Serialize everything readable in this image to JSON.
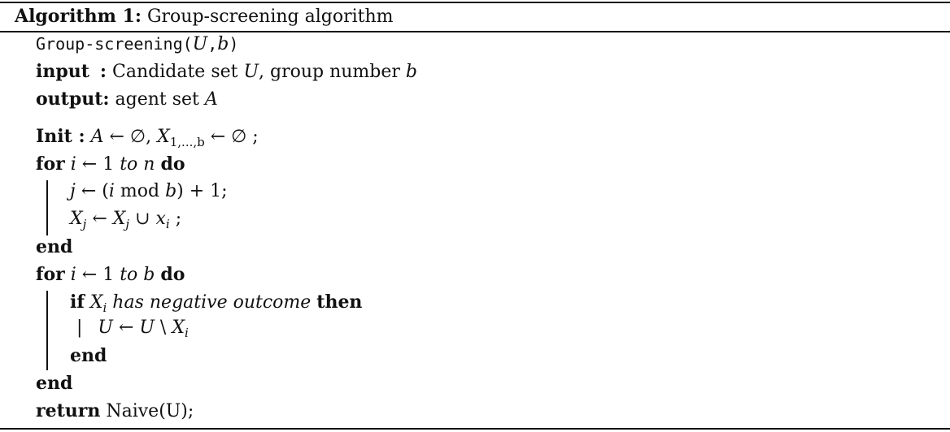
{
  "caption": {
    "label": "Algorithm 1:",
    "title": "Group-screening algorithm"
  },
  "lines": {
    "signature_name": "Group-screening(",
    "signature_arg1": "U",
    "signature_comma": ",",
    "signature_arg2": "b",
    "signature_close": ")",
    "input_kw": "input",
    "input_colon": ":",
    "input_text_1": "Candidate set ",
    "input_var_U": "U",
    "input_text_2": ", group number ",
    "input_var_b": "b",
    "output_kw": "output:",
    "output_text": "agent set ",
    "output_var": "A",
    "init_kw": "Init :",
    "init_A": "A",
    "init_arrow1": " ← ∅, ",
    "init_X": "X",
    "init_sub": "1,...,b",
    "init_arrow2": " ← ∅ ;",
    "for1_kw": "for",
    "for1_i": "i",
    "for1_arrow": " ← 1 ",
    "for1_to": "to n",
    "for1_do": "do",
    "body1_j": "j",
    "body1_rest1": " ← (",
    "body1_i": "i",
    "body1_mod": " mod ",
    "body1_b": "b",
    "body1_rest2": ") + 1;",
    "body2_X": "X",
    "body2_sub_j": "j",
    "body2_arrow": " ← ",
    "body2_X2": "X",
    "body2_sub_j2": "j",
    "body2_cup": " ∪ ",
    "body2_x": "x",
    "body2_sub_i": "i",
    "body2_end": " ;",
    "end1": "end",
    "for2_kw": "for",
    "for2_i": "i",
    "for2_arrow": " ← 1 ",
    "for2_to": "to b",
    "for2_do": "do",
    "if_kw": "if",
    "if_X": "X",
    "if_sub_i": "i",
    "if_text": " has negative outcome ",
    "if_then": "then",
    "update_bar": "|",
    "update_U": "U",
    "update_arrow": " ← ",
    "update_U2": "U",
    "update_setminus": " \\ ",
    "update_X": "X",
    "update_sub_i": "i",
    "end_if": "end",
    "end2": "end",
    "return_kw": "return",
    "return_text": " Naive(U);"
  }
}
